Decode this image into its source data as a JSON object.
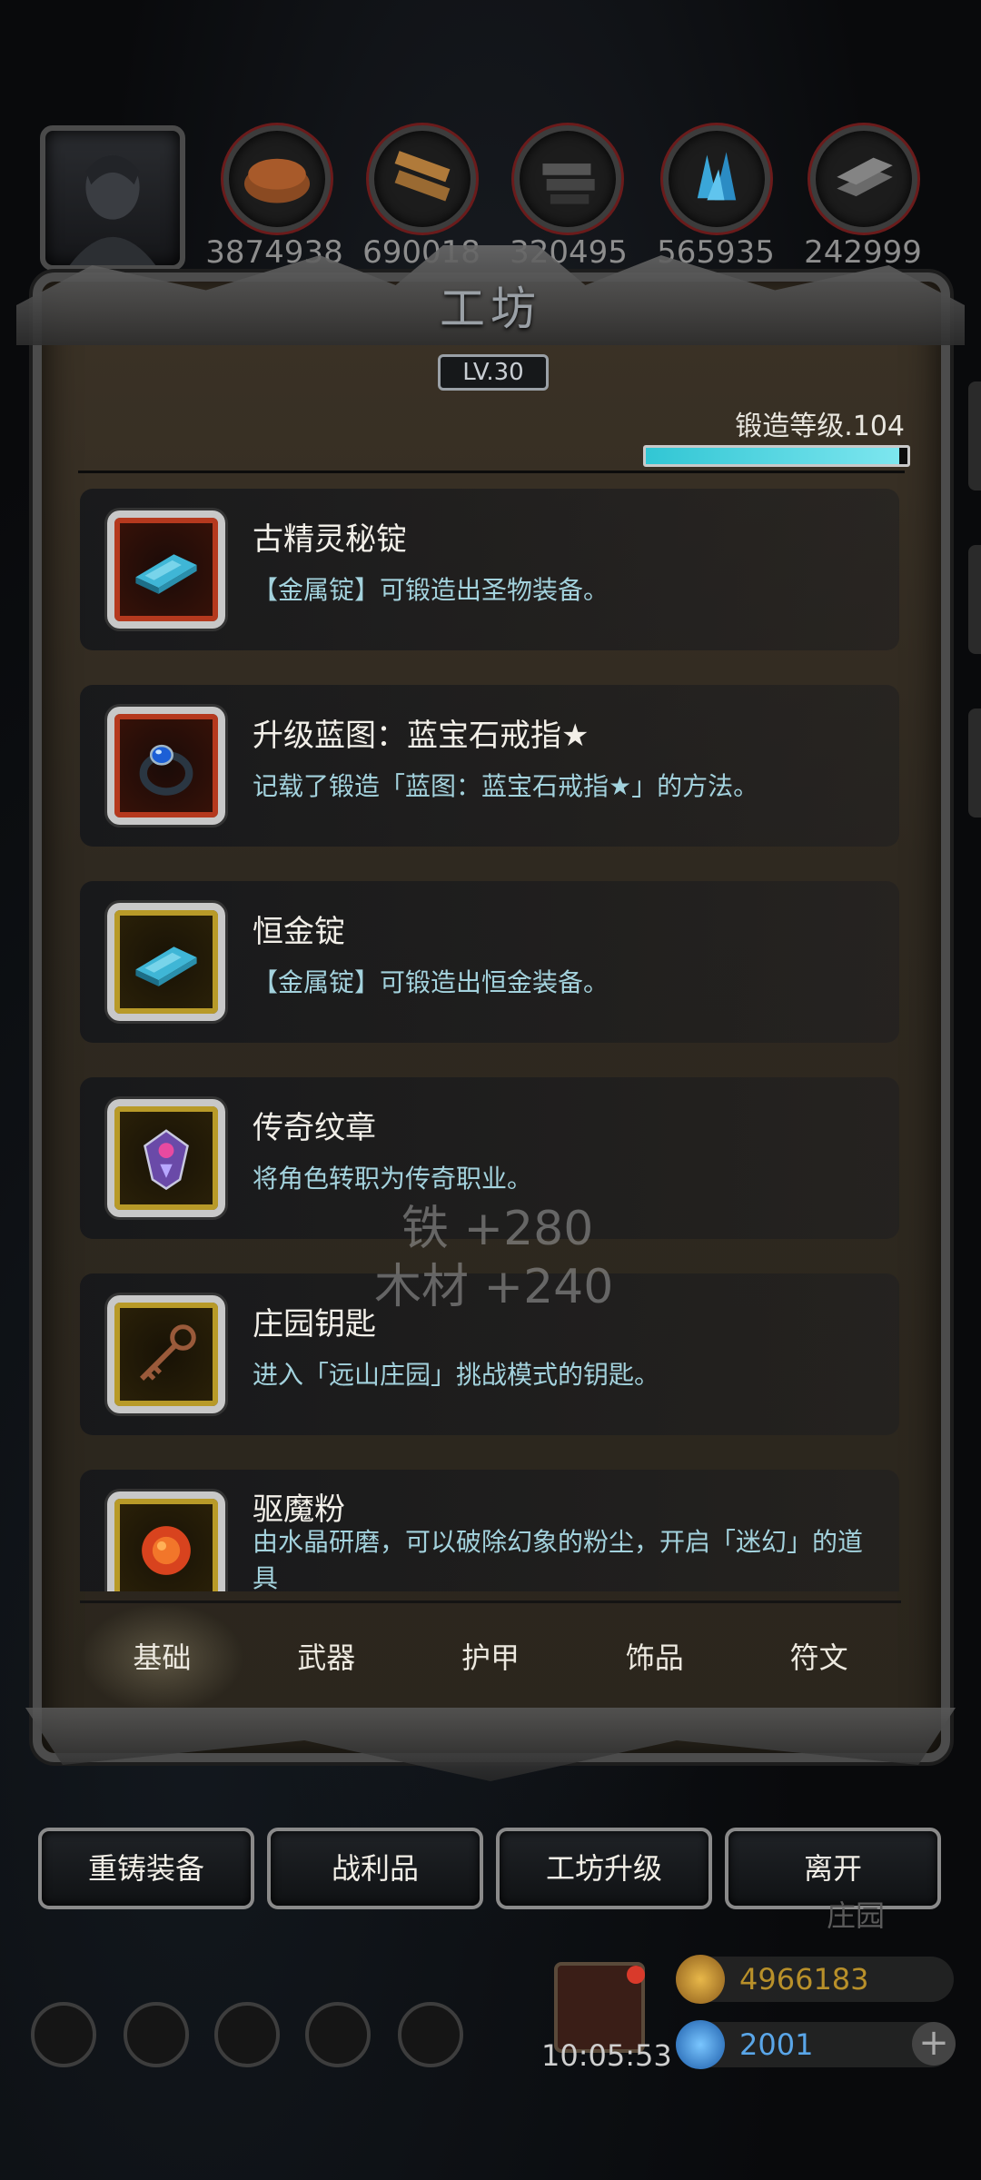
{
  "resources": [
    {
      "icon": "leather-icon",
      "value": "3874938"
    },
    {
      "icon": "wood-planks-icon",
      "value": "690018"
    },
    {
      "icon": "iron-bars-icon",
      "value": "320495"
    },
    {
      "icon": "blue-crystal-icon",
      "value": "565935"
    },
    {
      "icon": "steel-ingot-icon",
      "value": "242999"
    }
  ],
  "panel": {
    "title": "工坊",
    "level": "LV.30",
    "forge_label": "锻造等级.104",
    "forge_progress": 0.97
  },
  "items": [
    {
      "title": "古精灵秘锭",
      "desc": "【金属锭】可锻造出圣物装备。",
      "icon": "blue-ingot-icon",
      "frame": "red"
    },
    {
      "title": "升级蓝图：蓝宝石戒指★",
      "desc": "记载了锻造「蓝图：蓝宝石戒指★」的方法。",
      "icon": "sapphire-ring-icon",
      "frame": "red"
    },
    {
      "title": "恒金锭",
      "desc": "【金属锭】可锻造出恒金装备。",
      "icon": "blue-ingot-icon",
      "frame": "gold"
    },
    {
      "title": "传奇纹章",
      "desc": "将角色转职为传奇职业。",
      "icon": "crest-icon",
      "frame": "gold"
    },
    {
      "title": "庄园钥匙",
      "desc": "进入「远山庄园」挑战模式的钥匙。",
      "icon": "key-icon",
      "frame": "gold"
    },
    {
      "title": "驱魔粉",
      "desc": "由水晶研磨，可以破除幻象的粉尘，开启「迷幻」的道具",
      "icon": "powder-icon",
      "frame": "gold"
    }
  ],
  "floating": {
    "iron": "铁 +280",
    "wood": "木材 +240"
  },
  "tabs": [
    "基础",
    "武器",
    "护甲",
    "饰品",
    "符文"
  ],
  "active_tab": 0,
  "buttons": {
    "reforge": "重铸装备",
    "loot": "战利品",
    "upgrade": "工坊升级",
    "leave": "离开"
  },
  "hud": {
    "time": "10:05:53",
    "gold": "4966183",
    "gems": "2001",
    "behind_label": "庄园"
  }
}
